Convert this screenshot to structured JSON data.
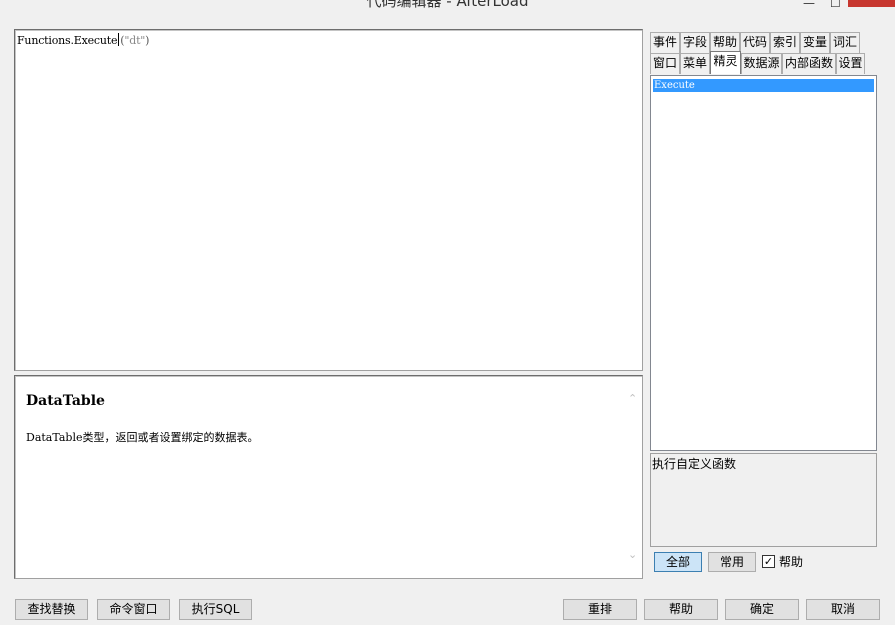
{
  "window": {
    "title": "代码编辑器 - AfterLoad",
    "minimize_glyph": "—",
    "maximize_glyph": "☐"
  },
  "editor": {
    "code_prefix": "Functions.Execute",
    "code_open_paren": "(",
    "code_string": "\"dt\"",
    "code_close_paren": ")"
  },
  "help": {
    "title": "DataTable",
    "description": "DataTable类型，返回或者设置绑定的数据表。"
  },
  "tabs": {
    "row1": [
      "事件",
      "字段",
      "帮助",
      "代码",
      "索引",
      "变量",
      "词汇"
    ],
    "row2": [
      "窗口",
      "菜单",
      "精灵",
      "数据源",
      "内部函数",
      "设置"
    ],
    "active": "精灵"
  },
  "list": {
    "items": [
      "Execute"
    ],
    "selected": "Execute"
  },
  "function_description": "执行自定义函数",
  "filter": {
    "all_label": "全部",
    "common_label": "常用",
    "help_checkbox_label": "帮助",
    "help_checked": true
  },
  "bottom_buttons": {
    "find_replace": "查找替换",
    "command_window": "命令窗口",
    "execute_sql": "执行SQL",
    "rearrange": "重排",
    "help": "帮助",
    "ok": "确定",
    "cancel": "取消"
  },
  "colors": {
    "selection": "#3399ff",
    "close_button": "#c7372f",
    "selected_button": "#cce4f7"
  }
}
